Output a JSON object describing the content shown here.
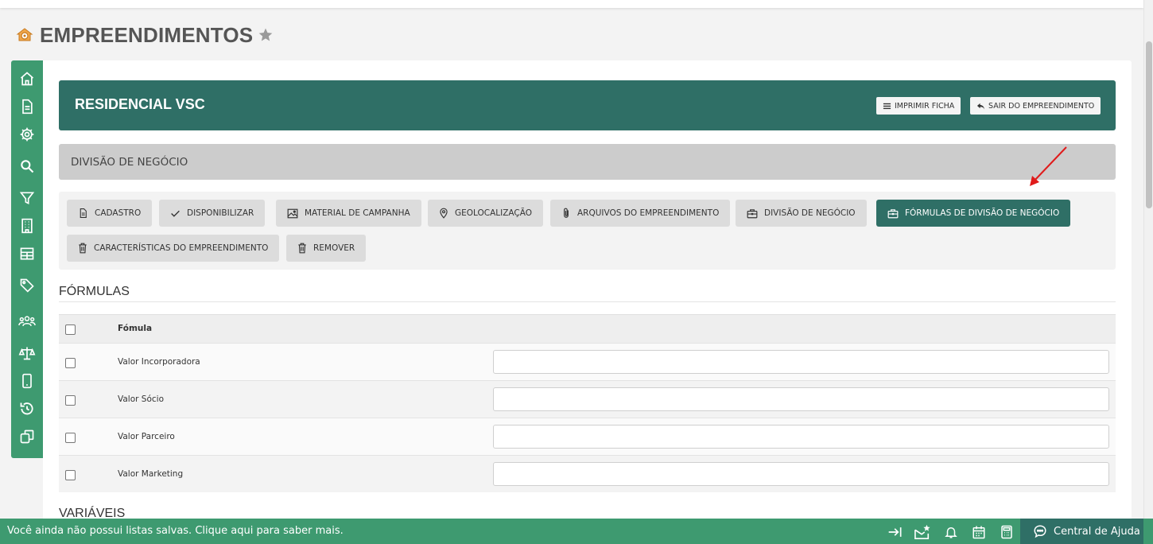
{
  "page": {
    "title": "EMPREENDIMENTOS"
  },
  "icons": {
    "logo": "house-gear-icon",
    "favorite": "star-icon"
  },
  "colors": {
    "primary": "#2f6f66",
    "sidebar": "#3e9a70",
    "section_bar": "#cccccc",
    "tab_inactive": "#dcdcdc",
    "annotation_arrow": "#e01b1b"
  },
  "sidebar": {
    "items": [
      {
        "icon": "home-icon"
      },
      {
        "icon": "document-icon"
      },
      {
        "icon": "gear-icon"
      },
      {
        "icon": "search-icon"
      },
      {
        "icon": "filter-icon"
      },
      {
        "icon": "building-icon"
      },
      {
        "icon": "table-icon"
      },
      {
        "icon": "tag-icon"
      },
      {
        "icon": "users-icon"
      },
      {
        "icon": "scale-icon"
      },
      {
        "icon": "mobile-icon"
      },
      {
        "icon": "history-icon"
      },
      {
        "icon": "copy-icon"
      }
    ]
  },
  "header": {
    "title": "RESIDENCIAL VSC",
    "print_label": "IMPRIMIR FICHA",
    "exit_label": "SAIR DO EMPREENDIMENTO"
  },
  "section": {
    "title": "DIVISÃO DE NEGÓCIO"
  },
  "tabs": [
    {
      "label": "CADASTRO",
      "icon": "document-icon"
    },
    {
      "label": "DISPONIBILIZAR",
      "icon": "check-icon"
    },
    {
      "label": "MATERIAL DE CAMPANHA",
      "icon": "image-icon"
    },
    {
      "label": "GEOLOCALIZAÇÃO",
      "icon": "map-pin-icon"
    },
    {
      "label": "ARQUIVOS DO EMPREENDIMENTO",
      "icon": "paperclip-icon"
    },
    {
      "label": "DIVISÃO DE NEGÓCIO",
      "icon": "briefcase-icon"
    },
    {
      "label": "FÓRMULAS DE DIVISÃO DE NEGÓCIO",
      "icon": "briefcase-icon",
      "active": true
    },
    {
      "label": "CARACTERÍSTICAS DO EMPREENDIMENTO",
      "icon": "trash-icon"
    },
    {
      "label": "REMOVER",
      "icon": "trash-icon"
    }
  ],
  "formulas": {
    "title": "FÓRMULAS",
    "column_header": "Fómula",
    "rows": [
      {
        "label": "Valor Incorporadora",
        "value": ""
      },
      {
        "label": "Valor Sócio",
        "value": ""
      },
      {
        "label": "Valor Parceiro",
        "value": ""
      },
      {
        "label": "Valor Marketing",
        "value": ""
      }
    ]
  },
  "variables": {
    "title": "VARIÁVEIS"
  },
  "footer": {
    "message": "Você ainda não possui listas salvas. Clique aqui para saber mais.",
    "icons": [
      "arrow-to-right-icon",
      "mail-star-icon",
      "bell-icon",
      "calendar-icon",
      "calculator-icon"
    ],
    "help_label": "Central de Ajuda"
  }
}
